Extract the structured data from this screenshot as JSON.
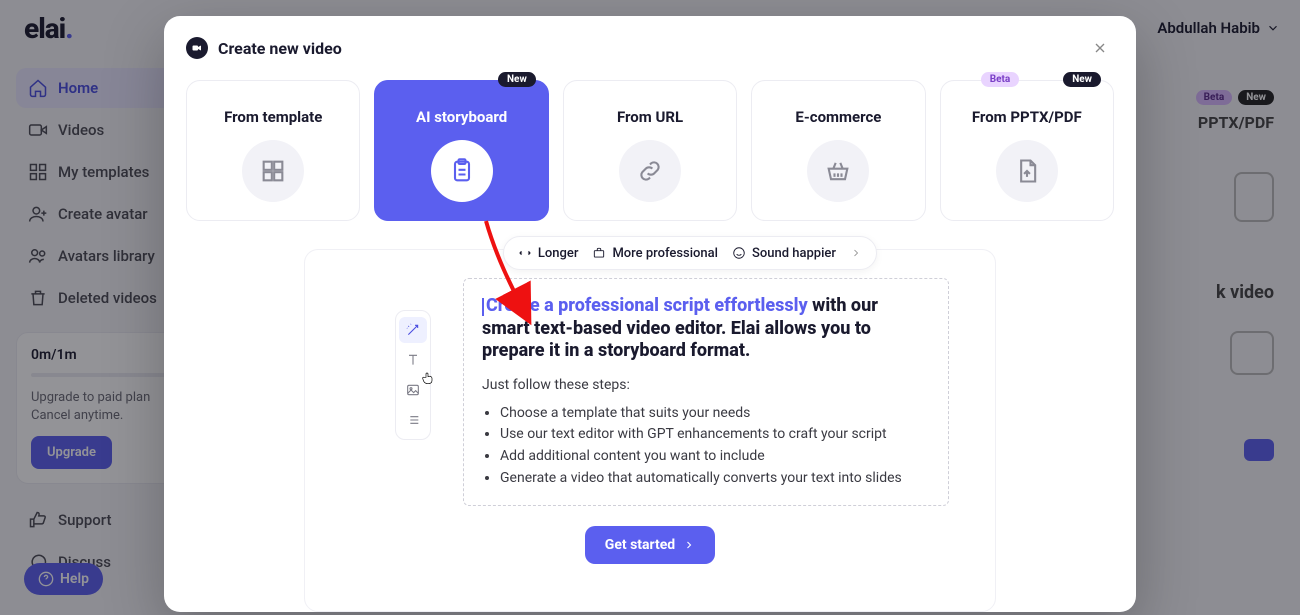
{
  "logo_text": "elai",
  "user_name": "Abdullah Habib",
  "sidebar": {
    "items": [
      {
        "label": "Home"
      },
      {
        "label": "Videos"
      },
      {
        "label": "My templates"
      },
      {
        "label": "Create avatar"
      },
      {
        "label": "Avatars library"
      },
      {
        "label": "Deleted videos"
      }
    ]
  },
  "quota": {
    "title": "0m/1m",
    "line1": "Upgrade to paid plan",
    "line2": "Cancel anytime.",
    "button": "Upgrade"
  },
  "support": {
    "support": "Support",
    "discuss": "Discuss",
    "help": "Help"
  },
  "bg": {
    "badge_beta": "Beta",
    "badge_new": "New",
    "pptx": "PPTX/PDF",
    "blank": "k video"
  },
  "modal": {
    "title": "Create new video",
    "options": [
      {
        "label": "From template"
      },
      {
        "label": "AI storyboard",
        "badge_new": "New"
      },
      {
        "label": "From URL"
      },
      {
        "label": "E-commerce"
      },
      {
        "label": "From PPTX/PDF",
        "badge_beta": "Beta",
        "badge_new": "New"
      }
    ],
    "pills": {
      "longer": "Longer",
      "professional": "More professional",
      "happier": "Sound happier"
    },
    "script": {
      "headline_hl": "Create a professional script effortlessly",
      "headline_rest": " with our smart text-based video editor. Elai allows you to prepare it in a storyboard format.",
      "sub": "Just follow these steps:",
      "steps": [
        "Choose a template that suits your needs",
        "Use our text editor with GPT enhancements to craft your script",
        "Add additional content you want to include",
        "Generate a video that automatically converts your text into slides"
      ]
    },
    "cta": "Get started"
  }
}
